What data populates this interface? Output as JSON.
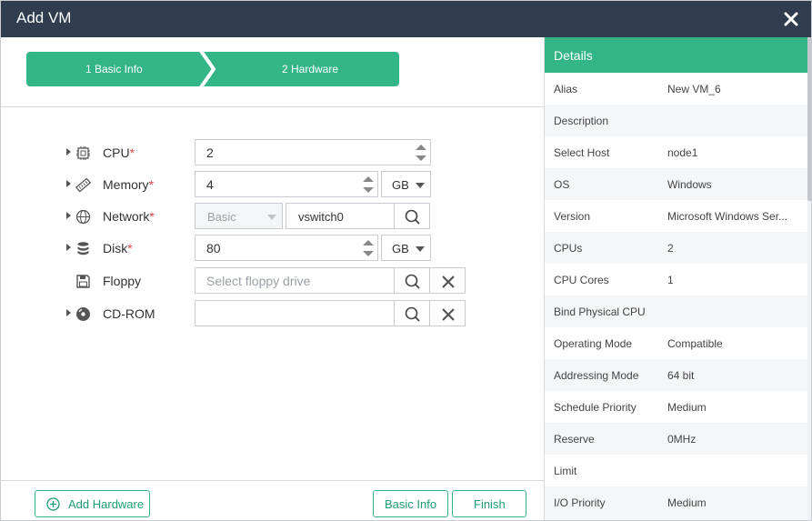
{
  "window": {
    "title": "Add VM"
  },
  "steps": [
    {
      "label": "1 Basic Info"
    },
    {
      "label": "2 Hardware"
    }
  ],
  "form": {
    "cpu": {
      "label": "CPU",
      "required": "*",
      "value": "2"
    },
    "memory": {
      "label": "Memory",
      "required": "*",
      "value": "4",
      "unit": "GB"
    },
    "network": {
      "label": "Network",
      "required": "*",
      "type": "Basic",
      "value": "vswitch0"
    },
    "disk": {
      "label": "Disk",
      "required": "*",
      "value": "80",
      "unit": "GB"
    },
    "floppy": {
      "label": "Floppy",
      "placeholder": "Select floppy drive"
    },
    "cdrom": {
      "label": "CD-ROM",
      "value": ""
    }
  },
  "footer": {
    "add_hardware": "Add Hardware",
    "basic_info": "Basic Info",
    "finish": "Finish"
  },
  "details": {
    "title": "Details",
    "rows": [
      {
        "key": "Alias",
        "value": "New VM_6"
      },
      {
        "key": "Description",
        "value": ""
      },
      {
        "key": "Select Host",
        "value": "node1"
      },
      {
        "key": "OS",
        "value": "Windows"
      },
      {
        "key": "Version",
        "value": "Microsoft Windows Ser..."
      },
      {
        "key": "CPUs",
        "value": "2"
      },
      {
        "key": "CPU Cores",
        "value": "1"
      },
      {
        "key": "Bind Physical CPU",
        "value": ""
      },
      {
        "key": "Operating Mode",
        "value": "Compatible"
      },
      {
        "key": "Addressing Mode",
        "value": "64 bit"
      },
      {
        "key": "Schedule Priority",
        "value": "Medium"
      },
      {
        "key": "Reserve",
        "value": "0MHz"
      },
      {
        "key": "Limit",
        "value": ""
      },
      {
        "key": "I/O Priority",
        "value": "Medium"
      }
    ]
  },
  "colors": {
    "accent": "#33b588",
    "titlebar": "#2f3d4f",
    "required": "#e04545"
  }
}
